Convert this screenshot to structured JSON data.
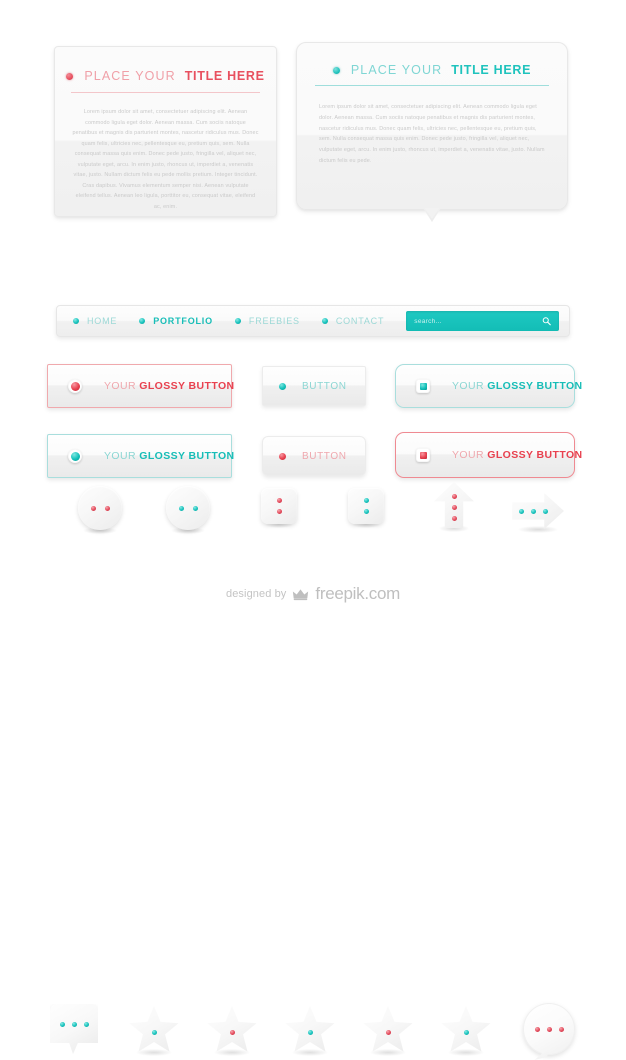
{
  "panels": [
    {
      "id": "panel-red",
      "theme": "red",
      "title_light": "PLACE YOUR",
      "title_bold": "TITLE HERE",
      "body": "Lorem ipsum dolor sit amet, consectetuer adipiscing elit. Aenean commodo ligula eget dolor. Aenean massa. Cum sociis natoque penatibus et magnis dis parturient montes, nascetur ridiculus mus. Donec quam felis, ultricies nec, pellentesque eu, pretium quis, sem. Nulla consequat massa quis enim. Donec pede justo, fringilla vel, aliquet nec, vulputate eget, arcu. In enim justo, rhoncus ut, imperdiet a, venenatis vitae, justo. Nullam dictum felis eu pede mollis pretium. Integer tincidunt. Cras dapibus. Vivamus elementum semper nisi. Aenean vulputate eleifend tellus. Aenean leo ligula, porttitor eu, consequat vitae, eleifend ac, enim.",
      "accent": "#e8505f"
    },
    {
      "id": "panel-teal",
      "theme": "teal",
      "title_light": "PLACE YOUR",
      "title_bold": "TITLE HERE",
      "body": "Lorem ipsum dolor sit amet, consectetuer adipiscing elit. Aenean commodo ligula eget dolor. Aenean massa. Cum sociis natoque penatibus et magnis dis parturient montes, nascetur ridiculus mus. Donec quam felis, ultricies nec, pellentesque eu, pretium quis, sem. Nulla consequat massa quis enim. Donec pede justo, fringilla vel, aliquet nec, vulputate eget, arcu. In enim justo, rhoncus ut, imperdiet a, venenatis vitae, justo. Nullam dictum felis eu pede.",
      "accent": "#1fc3bd"
    }
  ],
  "shapes": [
    {
      "name": "circle-two-dots-red",
      "icon": "circle-icon",
      "dots": 2,
      "color": "red"
    },
    {
      "name": "circle-two-dots-teal",
      "icon": "circle-icon",
      "dots": 2,
      "color": "teal"
    },
    {
      "name": "square-two-dots-red",
      "icon": "square-icon",
      "dots": 2,
      "color": "red"
    },
    {
      "name": "square-two-dots-teal",
      "icon": "square-icon",
      "dots": 2,
      "color": "teal"
    },
    {
      "name": "arrow-up-three-dots-red",
      "icon": "arrow-up-icon",
      "dots": 3,
      "color": "red"
    },
    {
      "name": "arrow-right-three-dots-teal",
      "icon": "arrow-right-icon",
      "dots": 3,
      "color": "teal"
    }
  ],
  "navbar": {
    "items": [
      {
        "label": "HOME",
        "active": false
      },
      {
        "label": "PORTFOLIO",
        "active": true
      },
      {
        "label": "FREEBIES",
        "active": false
      },
      {
        "label": "CONTACT",
        "active": false
      }
    ],
    "search": {
      "placeholder": "search...",
      "value": "",
      "icon": "magnifier-icon",
      "background": "#16c2bc"
    }
  },
  "buttons": [
    {
      "id": "btn-glossy-red-square",
      "label_light": "YOUR",
      "label_bold": "GLOSSY BUTTON",
      "indicator": "round",
      "color": "red",
      "corners": "square"
    },
    {
      "id": "btn-plain-teal-square",
      "label_light": "BUTTON",
      "label_bold": "",
      "indicator": "small",
      "color": "teal",
      "corners": "square"
    },
    {
      "id": "btn-glossy-teal-rounded",
      "label_light": "YOUR",
      "label_bold": "GLOSSY BUTTON",
      "indicator": "square",
      "color": "teal",
      "corners": "rounded"
    },
    {
      "id": "btn-glossy-teal-square",
      "label_light": "YOUR",
      "label_bold": "GLOSSY BUTTON",
      "indicator": "round",
      "color": "teal",
      "corners": "square"
    },
    {
      "id": "btn-plain-red-rounded",
      "label_light": "BUTTON",
      "label_bold": "",
      "indicator": "small",
      "color": "red",
      "corners": "rounded"
    },
    {
      "id": "btn-glossy-red-rounded",
      "label_light": "YOUR",
      "label_bold": "GLOSSY BUTTON",
      "indicator": "square",
      "color": "red",
      "corners": "rounded"
    }
  ],
  "icons": [
    {
      "name": "square-speech-bubble",
      "icon": "speech-bubble-square-icon",
      "dots": 3,
      "color": "teal"
    },
    {
      "name": "star-1",
      "icon": "star-icon",
      "dots": 1,
      "color": "teal"
    },
    {
      "name": "star-2",
      "icon": "star-icon",
      "dots": 1,
      "color": "red"
    },
    {
      "name": "star-3",
      "icon": "star-icon",
      "dots": 1,
      "color": "teal"
    },
    {
      "name": "star-4",
      "icon": "star-icon",
      "dots": 1,
      "color": "red"
    },
    {
      "name": "star-5",
      "icon": "star-icon",
      "dots": 1,
      "color": "teal"
    },
    {
      "name": "round-speech-bubble",
      "icon": "speech-bubble-round-icon",
      "dots": 3,
      "color": "red"
    }
  ],
  "footer": {
    "designed_by": "designed by",
    "brand": "freepik.com",
    "icon": "crown-icon"
  },
  "colors": {
    "red": "#e8505f",
    "red_light": "#efa8ae",
    "teal": "#17bdb7",
    "teal_light": "#8cd6d3",
    "body_text": "#c9c9c9",
    "surface": "#f7f7f7",
    "background": "#ffffff"
  }
}
